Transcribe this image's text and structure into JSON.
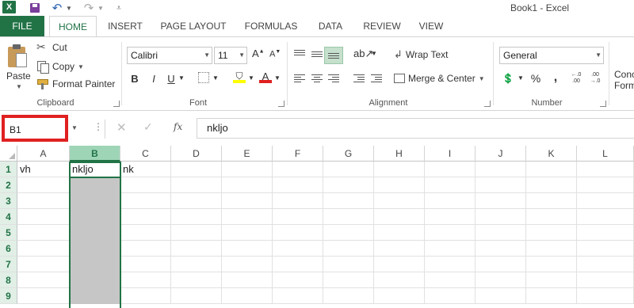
{
  "window": {
    "title": "Book1 - Excel",
    "app_icon": "X"
  },
  "tabs": [
    "FILE",
    "HOME",
    "INSERT",
    "PAGE LAYOUT",
    "FORMULAS",
    "DATA",
    "REVIEW",
    "VIEW"
  ],
  "ribbon": {
    "clipboard": {
      "paste": "Paste",
      "cut": "Cut",
      "copy": "Copy",
      "format_painter": "Format Painter",
      "label": "Clipboard"
    },
    "font": {
      "name": "Calibri",
      "size": "11",
      "grow": "A",
      "shrink": "A",
      "bold": "B",
      "italic": "I",
      "underline": "U",
      "font_color_letter": "A",
      "label": "Font"
    },
    "alignment": {
      "wrap_text": "Wrap Text",
      "merge_center": "Merge & Center",
      "label": "Alignment"
    },
    "number": {
      "format": "General",
      "percent": "%",
      "comma": ",",
      "inc_decimal": ".00 .0",
      "label": "Number"
    },
    "styles": {
      "conditional_1": "Conc",
      "conditional_2": "Form"
    }
  },
  "formula_bar": {
    "name_box": "B1",
    "fx": "fx",
    "value": "nkljo"
  },
  "grid": {
    "columns": [
      "A",
      "B",
      "C",
      "D",
      "E",
      "F",
      "G",
      "H",
      "I",
      "J",
      "K",
      "L"
    ],
    "rows": [
      "1",
      "2",
      "3",
      "4",
      "5",
      "6",
      "7",
      "8",
      "9"
    ],
    "cells": {
      "A1": "vh",
      "B1": "nkljo",
      "C1": "nk"
    },
    "selected_column": "B",
    "active_cell": "B1"
  },
  "colors": {
    "accent": "#217346",
    "highlight": "#e02020",
    "selection_fill": "#c6c6c6"
  }
}
